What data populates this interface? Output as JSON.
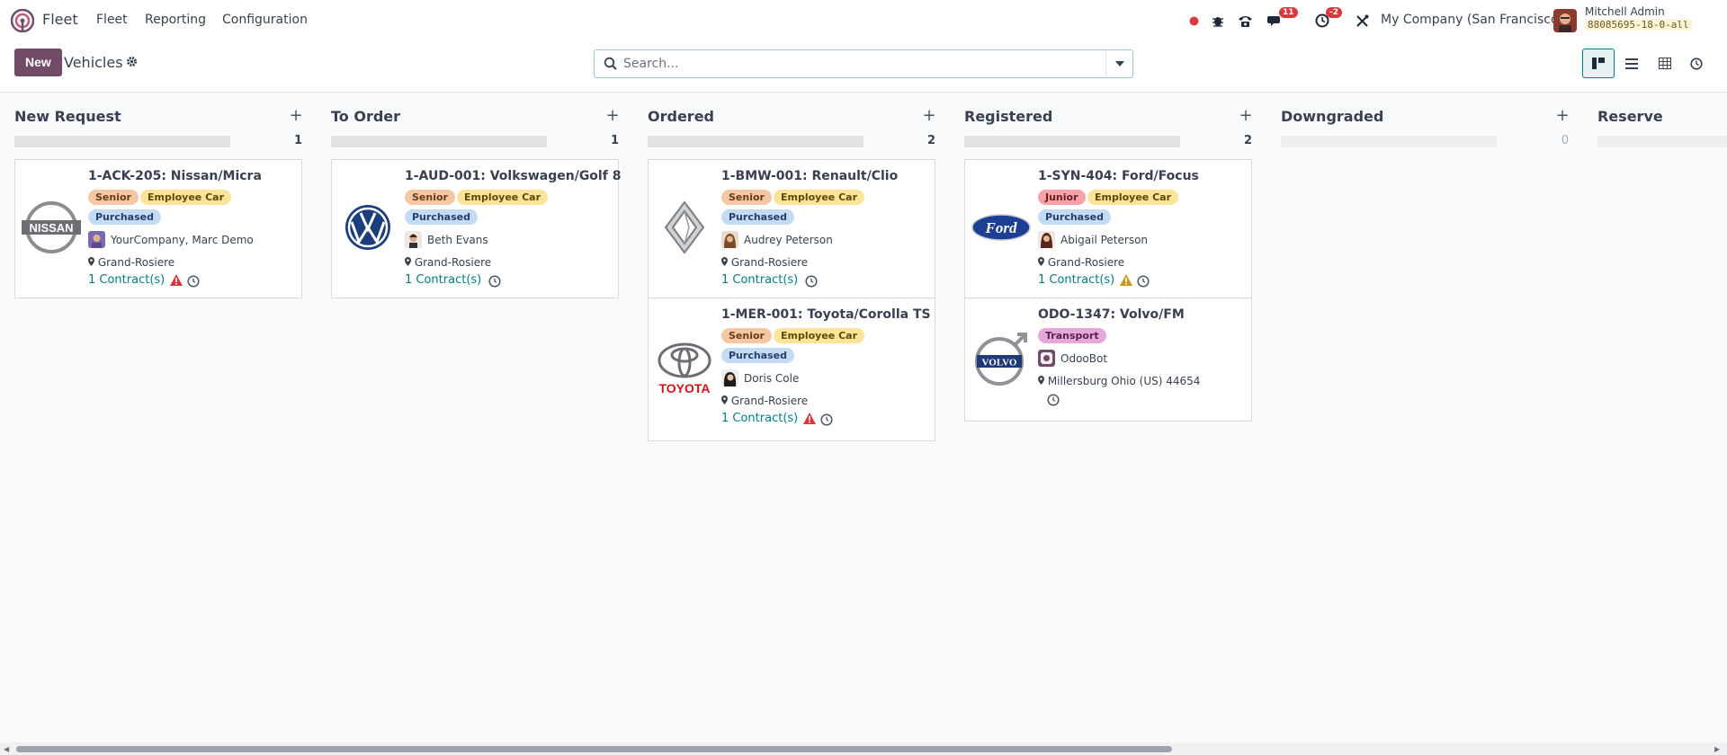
{
  "navbar": {
    "app_name": "Fleet",
    "menus": [
      "Fleet",
      "Reporting",
      "Configuration"
    ],
    "messages_badge": "11",
    "activities_badge": "-2",
    "company": "My Company (San Francisco)",
    "user_name": "Mitchell Admin",
    "db_name": "88085695-18-0-all"
  },
  "control": {
    "new_label": "New",
    "title": "Vehicles",
    "search_placeholder": "Search...",
    "views": [
      "kanban-view",
      "list-view",
      "pivot-view",
      "activity-view"
    ],
    "active_view": "kanban-view"
  },
  "columns": [
    {
      "title": "New Request",
      "count": "1"
    },
    {
      "title": "To Order",
      "count": "1"
    },
    {
      "title": "Ordered",
      "count": "2"
    },
    {
      "title": "Registered",
      "count": "2"
    },
    {
      "title": "Downgraded",
      "count": "0"
    },
    {
      "title": "Reserve",
      "count": ""
    }
  ],
  "cards": [
    {
      "name": "1-ACK-205: Nissan/Micra",
      "brand": "nissan-logo",
      "tags": [
        "Senior",
        "Employee Car",
        "Purchased"
      ],
      "driver": "YourCompany, Marc Demo",
      "location": "Grand-Rosiere",
      "contracts": "1 Contract(s)",
      "contract_warning": "red"
    },
    {
      "name": "1-AUD-001: Volkswagen/Golf 8",
      "brand": "volkswagen-logo",
      "tags": [
        "Senior",
        "Employee Car",
        "Purchased"
      ],
      "driver": "Beth Evans",
      "location": "Grand-Rosiere",
      "contracts": "1 Contract(s)",
      "contract_warning": ""
    },
    {
      "name": "1-BMW-001: Renault/Clio",
      "brand": "renault-logo",
      "tags": [
        "Senior",
        "Employee Car",
        "Purchased"
      ],
      "driver": "Audrey Peterson",
      "location": "Grand-Rosiere",
      "contracts": "1 Contract(s)",
      "contract_warning": ""
    },
    {
      "name": "1-MER-001: Toyota/Corolla TS",
      "brand": "toyota-logo",
      "brand_text": "TOYOTA",
      "tags": [
        "Senior",
        "Employee Car",
        "Purchased"
      ],
      "driver": "Doris Cole",
      "location": "Grand-Rosiere",
      "contracts": "1 Contract(s)",
      "contract_warning": "red"
    },
    {
      "name": "1-SYN-404: Ford/Focus",
      "brand": "ford-logo",
      "brand_text": "Ford",
      "tags": [
        "Junior",
        "Employee Car",
        "Purchased"
      ],
      "driver": "Abigail Peterson",
      "location": "Grand-Rosiere",
      "contracts": "1 Contract(s)",
      "contract_warning": "orange"
    },
    {
      "name": "ODO-1347: Volvo/FM",
      "brand": "volvo-logo",
      "brand_text": "VOLVO",
      "tags": [
        "Transport"
      ],
      "driver": "OdooBot",
      "location": "Millersburg Ohio (US) 44654",
      "contracts": "",
      "contract_warning": ""
    }
  ],
  "colors": {
    "primary": "#714b67",
    "link": "#017e84",
    "danger": "#d9383d",
    "warning": "#e0a020"
  }
}
